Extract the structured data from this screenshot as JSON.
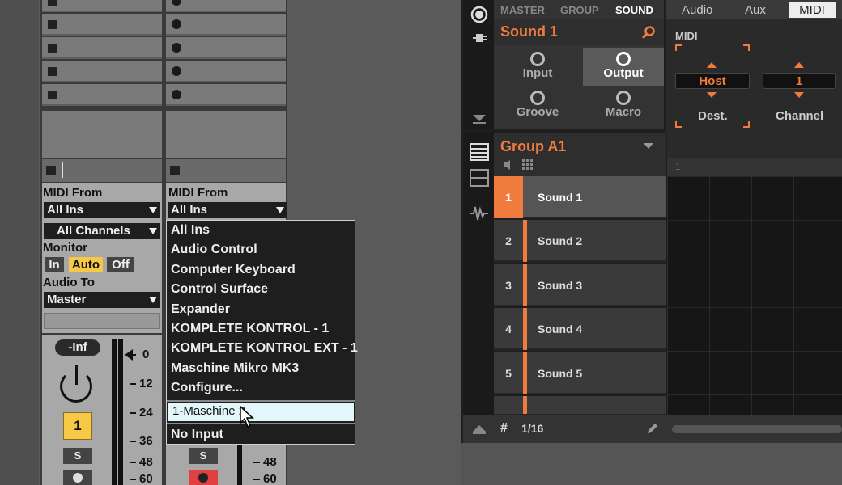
{
  "ableton": {
    "track1": {
      "midi_from_label": "MIDI From",
      "midi_from_value": "All Ins",
      "channel_value": "All Channels",
      "monitor_label": "Monitor",
      "monitor_in": "In",
      "monitor_auto": "Auto",
      "monitor_off": "Off",
      "audio_to_label": "Audio To",
      "audio_to_value": "Master",
      "volume": "-Inf",
      "track_number": "1",
      "solo": "S"
    },
    "track2": {
      "midi_from_label": "MIDI From",
      "midi_from_value": "All Ins",
      "solo": "S"
    },
    "scale": [
      "0",
      "12",
      "24",
      "36",
      "48",
      "60"
    ],
    "scale2": [
      "48",
      "60"
    ],
    "midi_from_menu": {
      "items": [
        "All Ins",
        "Audio Control",
        "Computer Keyboard",
        "Control Surface",
        "Expander",
        "KOMPLETE KONTROL - 1",
        "KOMPLETE KONTROL EXT - 1",
        "Maschine Mikro MK3",
        "Configure..."
      ],
      "highlighted": "1-Maschine 2",
      "last": "No Input"
    }
  },
  "maschine": {
    "tabs": [
      "MASTER",
      "GROUP",
      "SOUND"
    ],
    "active_tab": "SOUND",
    "sound_title": "Sound 1",
    "buttons": {
      "input": "Input",
      "output": "Output",
      "groove": "Groove",
      "macro": "Macro"
    },
    "right_tabs": [
      "Audio",
      "Aux",
      "MIDI"
    ],
    "midi_section_label": "MIDI",
    "dest_value": "Host",
    "channel_value": "1",
    "dest_label": "Dest.",
    "channel_label": "Channel",
    "group_name": "Group A1",
    "ruler_start": "1",
    "sounds": [
      {
        "num": "1",
        "name": "Sound 1"
      },
      {
        "num": "2",
        "name": "Sound 2"
      },
      {
        "num": "3",
        "name": "Sound 3"
      },
      {
        "num": "4",
        "name": "Sound 4"
      },
      {
        "num": "5",
        "name": "Sound 5"
      }
    ],
    "quantize": "1/16",
    "accent_color": "#f07b3f"
  }
}
